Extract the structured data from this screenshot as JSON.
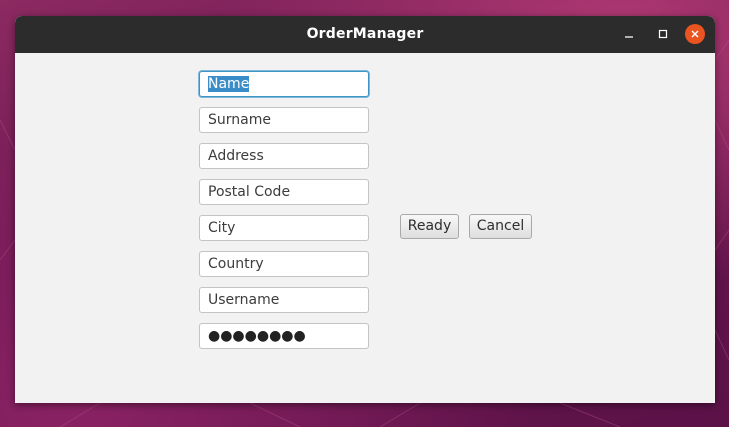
{
  "window": {
    "title": "OrderManager",
    "controls": {
      "minimize_icon": "minimize-icon",
      "maximize_icon": "maximize-icon",
      "close_icon": "close-icon"
    }
  },
  "form": {
    "fields": [
      {
        "id": "name",
        "value": "Name",
        "focused": true,
        "selected": true
      },
      {
        "id": "surname",
        "value": "Surname"
      },
      {
        "id": "address",
        "value": "Address"
      },
      {
        "id": "postal_code",
        "value": "Postal Code"
      },
      {
        "id": "city",
        "value": "City"
      },
      {
        "id": "country",
        "value": "Country"
      },
      {
        "id": "username",
        "value": "Username"
      },
      {
        "id": "password",
        "value": "●●●●●●●●",
        "masked": true
      }
    ]
  },
  "buttons": {
    "ready": "Ready",
    "cancel": "Cancel"
  },
  "colors": {
    "titlebar": "#2c2c2c",
    "close_button": "#e95420",
    "focus_border": "#3f94c6",
    "selection": "#3a8dc8",
    "window_background": "#f2f2f2"
  }
}
